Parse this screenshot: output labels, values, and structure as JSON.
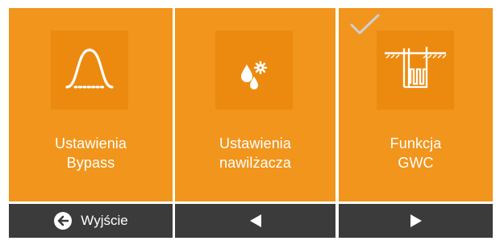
{
  "tiles": [
    {
      "line1": "Ustawienia",
      "line2": "Bypass",
      "icon": "bypass-curve-icon"
    },
    {
      "line1": "Ustawienia",
      "line2": "nawilżacza",
      "icon": "humidifier-drops-icon"
    },
    {
      "line1": "Funkcja",
      "line2": "GWC",
      "icon": "gwc-exchanger-icon",
      "selected": true
    }
  ],
  "footer": {
    "exit_label": "Wyjście",
    "exit_icon": "exit-arrow-icon",
    "prev_icon": "triangle-left-icon",
    "next_icon": "triangle-right-icon"
  },
  "colors": {
    "panel": "#f1951c",
    "icon_box": "#ec8a10",
    "footer": "#3b3b3b",
    "text": "#ffffff",
    "check": "#cfcfcf"
  }
}
